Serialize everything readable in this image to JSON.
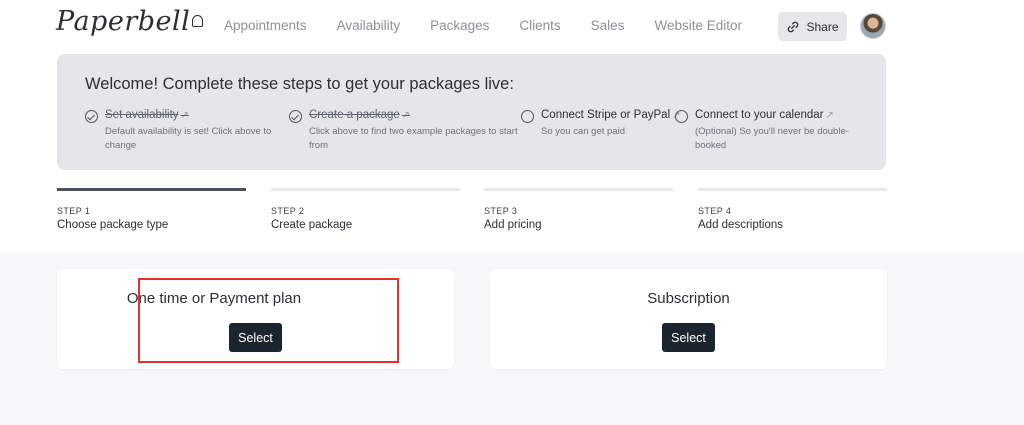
{
  "header": {
    "logo": "Paperbell",
    "nav": [
      "Appointments",
      "Availability",
      "Packages",
      "Clients",
      "Sales",
      "Website Editor"
    ],
    "share_label": "Share"
  },
  "welcome": {
    "title": "Welcome! Complete these steps to get your packages live:",
    "steps": [
      {
        "title": "Set availability",
        "desc": "Default availability is set! Click above to change",
        "done": true
      },
      {
        "title": "Create a package",
        "desc": "Click above to find two example packages to start from",
        "done": true
      },
      {
        "title": "Connect Stripe or PayPal",
        "desc": "So you can get paid",
        "done": false
      },
      {
        "title": "Connect to your calendar",
        "desc": "(Optional) So you'll never be double-booked",
        "done": false
      }
    ]
  },
  "progress": [
    {
      "num": "STEP 1",
      "label": "Choose package type",
      "active": true
    },
    {
      "num": "STEP 2",
      "label": "Create package",
      "active": false
    },
    {
      "num": "STEP 3",
      "label": "Add pricing",
      "active": false
    },
    {
      "num": "STEP 4",
      "label": "Add descriptions",
      "active": false
    }
  ],
  "cards": [
    {
      "title": "One time or Payment plan",
      "button": "Select"
    },
    {
      "title": "Subscription",
      "button": "Select"
    }
  ],
  "colors": {
    "highlight": "#e4312b",
    "button_bg": "#1c2430",
    "panel_bg": "#e4e6e9"
  }
}
